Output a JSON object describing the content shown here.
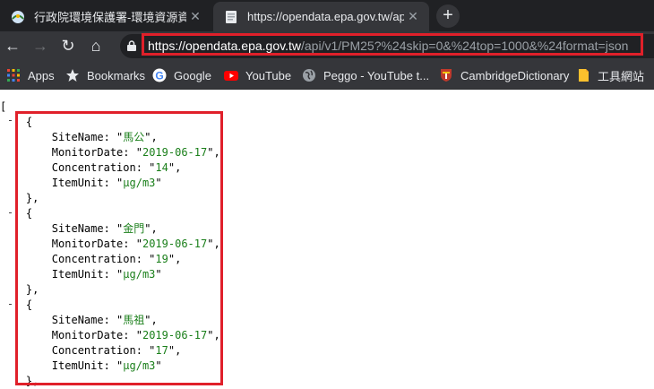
{
  "tabs": [
    {
      "title": "行政院環境保護署-環境資源資料",
      "close": "✕",
      "active": false
    },
    {
      "title": "https://opendata.epa.gov.tw/api/",
      "close": "✕",
      "active": true
    }
  ],
  "newtab": "+",
  "nav": {
    "back": "←",
    "forward": "→",
    "reload": "↻",
    "home": "⌂"
  },
  "url": {
    "host": "https://opendata.epa.gov.tw",
    "path": "/api/v1/PM25?%24skip=0&%24top=1000&%24format=json"
  },
  "bookmarks": [
    "Apps",
    "Bookmarks",
    "Google",
    "YouTube",
    "Peggo - YouTube t...",
    "CambridgeDictionary",
    "工具網站"
  ],
  "json": {
    "open": "[",
    "keys": {
      "site": "SiteName",
      "date": "MonitorDate",
      "conc": "Concentration",
      "unit": "ItemUnit"
    },
    "records": [
      {
        "SiteName": "馬公",
        "MonitorDate": "2019-06-17",
        "Concentration": "14",
        "ItemUnit": "μg/m3"
      },
      {
        "SiteName": "金門",
        "MonitorDate": "2019-06-17",
        "Concentration": "19",
        "ItemUnit": "μg/m3"
      },
      {
        "SiteName": "馬祖",
        "MonitorDate": "2019-06-17",
        "Concentration": "17",
        "ItemUnit": "μg/m3"
      }
    ]
  },
  "colors": {
    "highlight": "#e0202a",
    "string": "#1a7f1a",
    "chrome": "#35363a"
  }
}
